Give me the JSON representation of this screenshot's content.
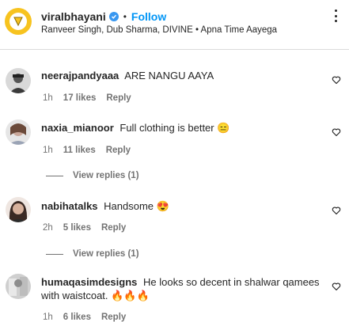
{
  "header": {
    "username": "viralbhayani",
    "separator": "•",
    "follow_label": "Follow",
    "subtitle": "Ranveer Singh, Dub Sharma, DIVINE • Apna Time Aayega"
  },
  "comments": [
    {
      "username": "neerajpandyaaa",
      "text": "ARE NANGU AAYA",
      "time": "1h",
      "likes": "17 likes",
      "reply": "Reply"
    },
    {
      "username": "naxia_mianoor",
      "text": "Full clothing is better",
      "emoji": "😑",
      "time": "1h",
      "likes": "11 likes",
      "reply": "Reply",
      "view_replies": "View replies (1)"
    },
    {
      "username": "nabihatalks",
      "text": "Handsome",
      "emoji": "😍",
      "time": "2h",
      "likes": "5 likes",
      "reply": "Reply",
      "view_replies": "View replies (1)"
    },
    {
      "username": "humaqasimdesigns",
      "text": "He looks so decent in shalwar qamees with waistcoat.",
      "emoji": "🔥🔥🔥",
      "time": "1h",
      "likes": "6 likes",
      "reply": "Reply"
    }
  ],
  "colors": {
    "accent": "#0095f6",
    "verified": "#3897f0",
    "brand_avatar": "#f7c31f",
    "muted_text": "#737373"
  },
  "icons": {
    "more": "more-options-icon",
    "like": "heart-icon",
    "verified": "verified-badge-icon"
  }
}
